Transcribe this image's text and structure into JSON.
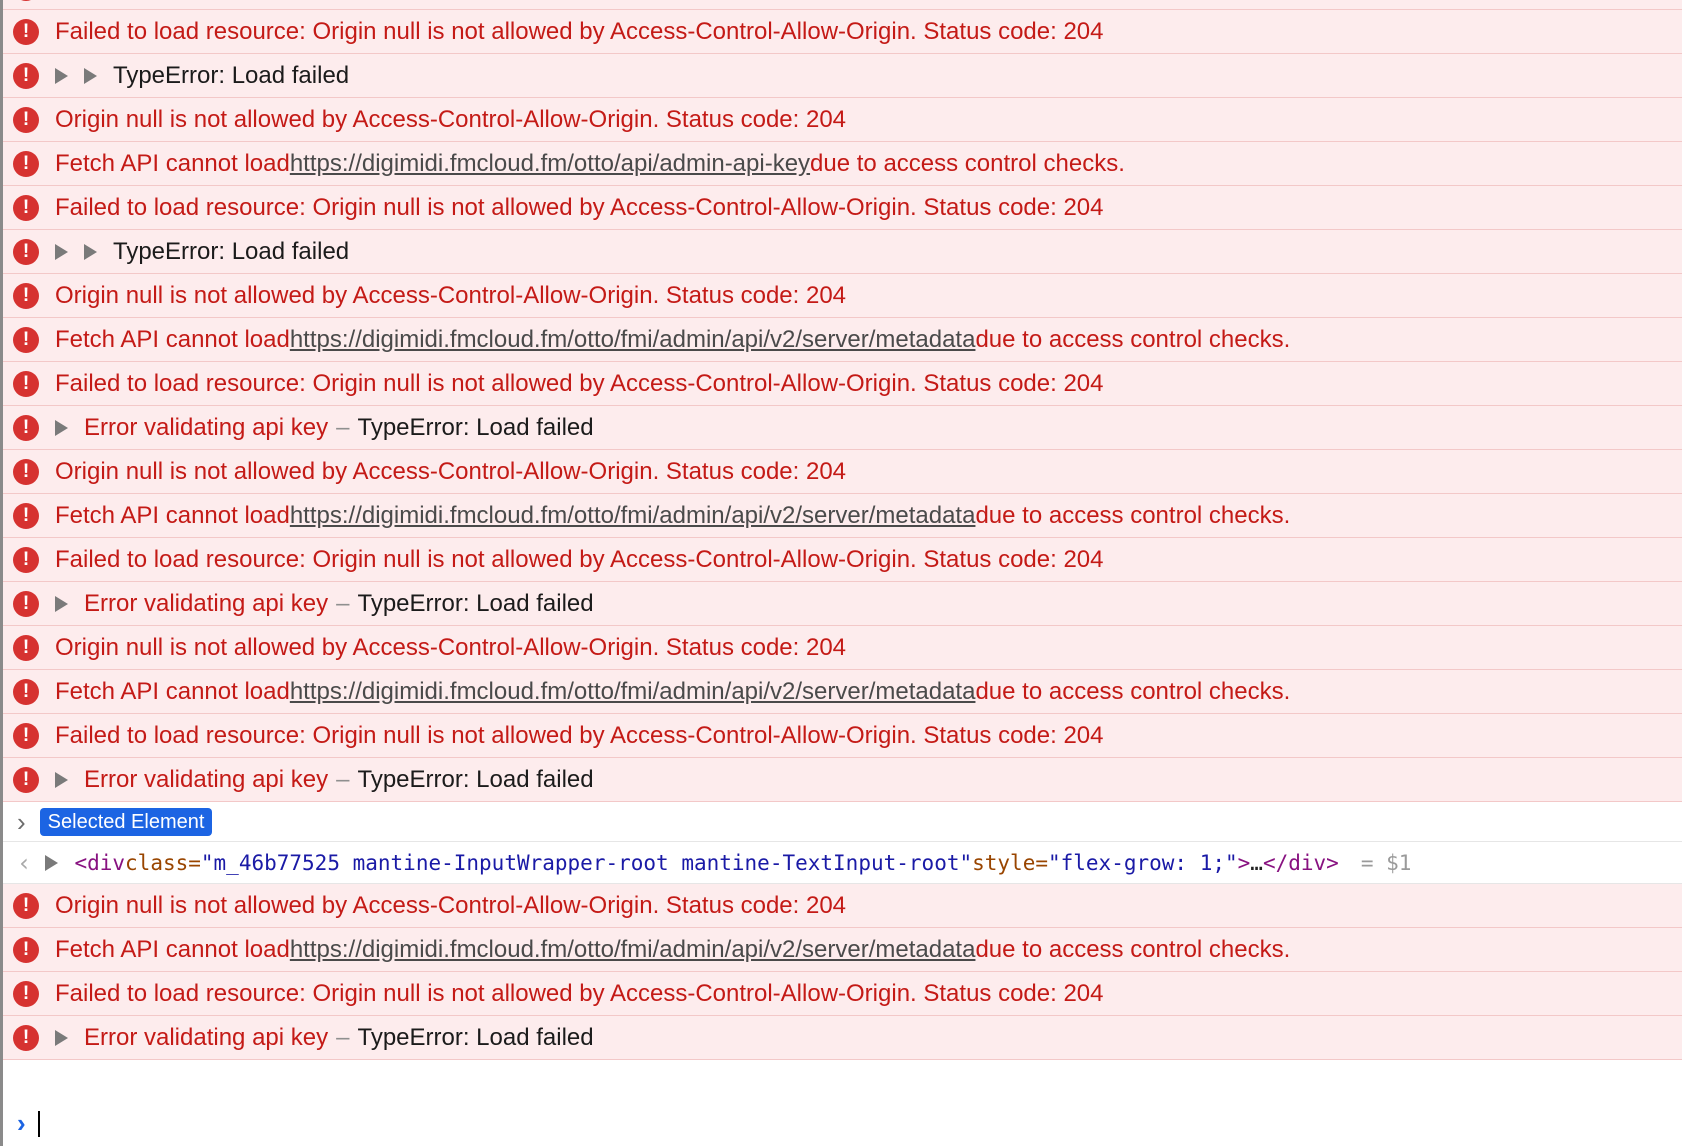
{
  "entries": [
    {
      "kind": "fetch",
      "prefix": "Fetch API cannot load ",
      "url": "https://digimidi.fmcloud.fm/otto/api/admin-api-key",
      "suffix": " due to access control checks."
    },
    {
      "kind": "msg",
      "text": "Failed to load resource: Origin null is not allowed by Access-Control-Allow-Origin. Status code: 204"
    },
    {
      "kind": "typeerror",
      "text": "TypeError: Load failed"
    },
    {
      "kind": "msg",
      "text": "Origin null is not allowed by Access-Control-Allow-Origin. Status code: 204"
    },
    {
      "kind": "fetch",
      "prefix": "Fetch API cannot load ",
      "url": "https://digimidi.fmcloud.fm/otto/api/admin-api-key",
      "suffix": " due to access control checks."
    },
    {
      "kind": "msg",
      "text": "Failed to load resource: Origin null is not allowed by Access-Control-Allow-Origin. Status code: 204"
    },
    {
      "kind": "typeerror",
      "text": "TypeError: Load failed"
    },
    {
      "kind": "msg",
      "text": "Origin null is not allowed by Access-Control-Allow-Origin. Status code: 204"
    },
    {
      "kind": "fetch",
      "prefix": "Fetch API cannot load ",
      "url": "https://digimidi.fmcloud.fm/otto/fmi/admin/api/v2/server/metadata",
      "suffix": " due to access control checks."
    },
    {
      "kind": "msg",
      "text": "Failed to load resource: Origin null is not allowed by Access-Control-Allow-Origin. Status code: 204"
    },
    {
      "kind": "apikey",
      "label": "Error validating api key",
      "dash": "–",
      "detail": "TypeError: Load failed"
    },
    {
      "kind": "msg",
      "text": "Origin null is not allowed by Access-Control-Allow-Origin. Status code: 204"
    },
    {
      "kind": "fetch",
      "prefix": "Fetch API cannot load ",
      "url": "https://digimidi.fmcloud.fm/otto/fmi/admin/api/v2/server/metadata",
      "suffix": " due to access control checks."
    },
    {
      "kind": "msg",
      "text": "Failed to load resource: Origin null is not allowed by Access-Control-Allow-Origin. Status code: 204"
    },
    {
      "kind": "apikey",
      "label": "Error validating api key",
      "dash": "–",
      "detail": "TypeError: Load failed"
    },
    {
      "kind": "msg",
      "text": "Origin null is not allowed by Access-Control-Allow-Origin. Status code: 204"
    },
    {
      "kind": "fetch",
      "prefix": "Fetch API cannot load ",
      "url": "https://digimidi.fmcloud.fm/otto/fmi/admin/api/v2/server/metadata",
      "suffix": " due to access control checks."
    },
    {
      "kind": "msg",
      "text": "Failed to load resource: Origin null is not allowed by Access-Control-Allow-Origin. Status code: 204"
    },
    {
      "kind": "apikey",
      "label": "Error validating api key",
      "dash": "–",
      "detail": "TypeError: Load failed"
    },
    {
      "kind": "selected",
      "badge": "Selected Element"
    },
    {
      "kind": "element",
      "open": "<div",
      "attr1": " class=",
      "val1": "\"m_46b77525 mantine-InputWrapper-root mantine-TextInput-root\"",
      "attr2": " style=",
      "val2": "\"flex-grow: 1;\"",
      "close": ">",
      "ellipsis": "…",
      "end": "</div>",
      "ref": "= $1"
    },
    {
      "kind": "msg",
      "text": "Origin null is not allowed by Access-Control-Allow-Origin. Status code: 204"
    },
    {
      "kind": "fetch",
      "prefix": "Fetch API cannot load ",
      "url": "https://digimidi.fmcloud.fm/otto/fmi/admin/api/v2/server/metadata",
      "suffix": " due to access control checks."
    },
    {
      "kind": "msg",
      "text": "Failed to load resource: Origin null is not allowed by Access-Control-Allow-Origin. Status code: 204"
    },
    {
      "kind": "apikey",
      "label": "Error validating api key",
      "dash": "–",
      "detail": "TypeError: Load failed"
    }
  ],
  "icons": {
    "error": "exclamation-circle-icon",
    "expand": "disclosure-triangle-icon",
    "prompt": "chevron-right-icon",
    "back": "chevron-left-icon"
  },
  "colors": {
    "error_text": "#c41a16",
    "error_bg": "#fdeced",
    "error_icon": "#d63230",
    "accent": "#1c64e3"
  }
}
